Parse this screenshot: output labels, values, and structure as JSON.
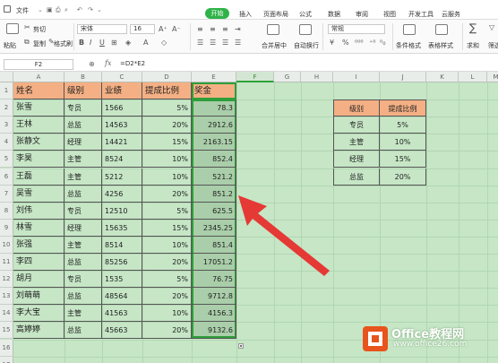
{
  "menubar": {
    "items": [
      "文件",
      "开始",
      "插入",
      "页面布局",
      "公式",
      "数据",
      "审阅",
      "视图",
      "开发工具",
      "云服务"
    ],
    "active_tab": "开始",
    "accent": "#2fb349"
  },
  "ribbon": {
    "cut": "剪切",
    "copy": "复制",
    "format_painter": "格式刷",
    "paste": "粘贴",
    "font_name": "宋体",
    "font_size": "16",
    "merge_center": "合并居中",
    "wrap": "自动换行",
    "number_format": "常规",
    "cond_format": "条件格式",
    "table_style": "表格样式",
    "sum": "求和",
    "filter": "筛选"
  },
  "formula_bar": {
    "name_box": "F2",
    "fx": "fx",
    "formula": "=D2*E2"
  },
  "columns": [
    "A",
    "B",
    "C",
    "D",
    "E",
    "F",
    "G",
    "H",
    "I",
    "J",
    "K",
    "L",
    "M"
  ],
  "rows": [
    "1",
    "2",
    "3",
    "4",
    "5",
    "6",
    "7",
    "8",
    "9",
    "10",
    "11",
    "12",
    "13",
    "14",
    "15",
    "16",
    "17"
  ],
  "main_table": {
    "headers": [
      "姓名",
      "级别",
      "业绩",
      "提成比例",
      "奖金"
    ],
    "rows": [
      [
        "张雪",
        "专员",
        "1566",
        "5%",
        "78.3"
      ],
      [
        "王林",
        "总监",
        "14563",
        "20%",
        "2912.6"
      ],
      [
        "张静文",
        "经理",
        "14421",
        "15%",
        "2163.15"
      ],
      [
        "李昊",
        "主管",
        "8524",
        "10%",
        "852.4"
      ],
      [
        "王磊",
        "主管",
        "5212",
        "10%",
        "521.2"
      ],
      [
        "吴雪",
        "总监",
        "4256",
        "20%",
        "851.2"
      ],
      [
        "刘伟",
        "专员",
        "12510",
        "5%",
        "625.5"
      ],
      [
        "林雪",
        "经理",
        "15635",
        "15%",
        "2345.25"
      ],
      [
        "张强",
        "主管",
        "8514",
        "10%",
        "851.4"
      ],
      [
        "李四",
        "总监",
        "85256",
        "20%",
        "17051.2"
      ],
      [
        "胡月",
        "专员",
        "1535",
        "5%",
        "76.75"
      ],
      [
        "刘萌萌",
        "总监",
        "48564",
        "20%",
        "9712.8"
      ],
      [
        "李大宝",
        "主管",
        "41563",
        "10%",
        "4156.3"
      ],
      [
        "高婷婷",
        "总监",
        "45663",
        "20%",
        "9132.6"
      ]
    ]
  },
  "rate_table": {
    "headers": [
      "级别",
      "提成比例"
    ],
    "rows": [
      [
        "专员",
        "5%"
      ],
      [
        "主管",
        "10%"
      ],
      [
        "经理",
        "15%"
      ],
      [
        "总监",
        "20%"
      ]
    ]
  },
  "watermark": {
    "brand": "Office教程网",
    "url": "www.office26.com"
  },
  "colors": {
    "sheet_bg": "#c6e6c6",
    "header_fill": "#f4b084",
    "arrow": "#e53935",
    "selection": "#2f9d3a"
  }
}
